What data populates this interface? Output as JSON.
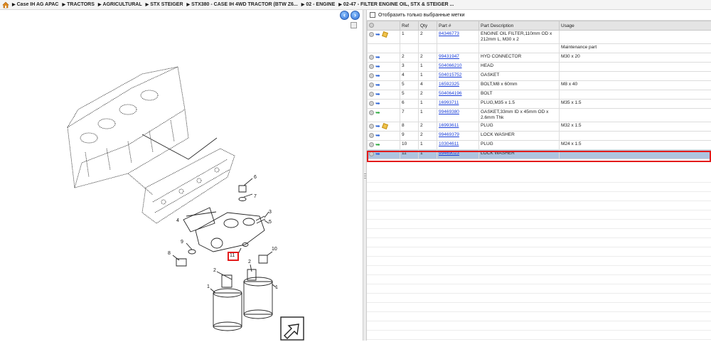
{
  "breadcrumb": [
    "Case IH AG APAC",
    "TRACTORS",
    "AGRICULTURAL",
    "STX STEIGER",
    "STX380 - CASE IH 4WD TRACTOR (BTW Z6...",
    "02 - ENGINE",
    "02-47 - FILTER ENGINE OIL, STX & STEIGER ..."
  ],
  "filter": {
    "label": "Отобразить только выбранные метки"
  },
  "table": {
    "headers": {
      "ref": "Ref",
      "qty": "Qty",
      "part": "Part #",
      "desc": "Part Description",
      "usage": "Usage"
    },
    "rows": [
      {
        "ref": "1",
        "qty": "2",
        "part": "84346773",
        "desc": "ENGINE OIL FILTER,110mm OD x 212mm L, M30 x 2",
        "usage": "",
        "arrow": "blue",
        "box": true
      },
      {
        "ref": "",
        "qty": "",
        "part": "",
        "desc": "",
        "usage": "Maintenance part",
        "arrow": "",
        "box": false
      },
      {
        "ref": "2",
        "qty": "2",
        "part": "99431947",
        "desc": "HYD CONNECTOR",
        "usage": "M30 x 20",
        "arrow": "blue",
        "box": false
      },
      {
        "ref": "3",
        "qty": "1",
        "part": "504066210",
        "desc": "HEAD",
        "usage": "",
        "arrow": "blue",
        "box": false
      },
      {
        "ref": "4",
        "qty": "1",
        "part": "504015752",
        "desc": "GASKET",
        "usage": "",
        "arrow": "blue",
        "box": false
      },
      {
        "ref": "5",
        "qty": "4",
        "part": "16592325",
        "desc": "BOLT,M8 x 60mm",
        "usage": "M8 x 40",
        "arrow": "blue",
        "box": false
      },
      {
        "ref": "5",
        "qty": "2",
        "part": "504064196",
        "desc": "BOLT",
        "usage": "",
        "arrow": "blue",
        "box": false
      },
      {
        "ref": "6",
        "qty": "1",
        "part": "16993711",
        "desc": "PLUG,M35 x 1.5",
        "usage": "M35 x 1.5",
        "arrow": "blue",
        "box": false
      },
      {
        "ref": "7",
        "qty": "1",
        "part": "99469380",
        "desc": "GASKET,33mm ID x 45mm OD x 2.6mm Thk",
        "usage": "",
        "arrow": "green",
        "box": false
      },
      {
        "ref": "8",
        "qty": "2",
        "part": "16993611",
        "desc": "PLUG",
        "usage": "M32 x 1.5",
        "arrow": "blue",
        "box": true
      },
      {
        "ref": "9",
        "qty": "2",
        "part": "99469379",
        "desc": "LOCK WASHER",
        "usage": "",
        "arrow": "blue",
        "box": false
      },
      {
        "ref": "10",
        "qty": "1",
        "part": "10304611",
        "desc": "PLUG",
        "usage": "M24 x 1.5",
        "arrow": "green",
        "box": false
      },
      {
        "ref": "11",
        "qty": "1",
        "part": "99469023",
        "desc": "LOCK WASHER",
        "usage": "",
        "arrow": "blue",
        "box": false,
        "selected": true
      }
    ]
  },
  "callouts": [
    "1",
    "1",
    "2",
    "2",
    "3",
    "4",
    "5",
    "6",
    "7",
    "8",
    "9",
    "10",
    "11"
  ],
  "colors": {
    "accent_red": "#e31b1b",
    "selected_row": "#aec4df",
    "link": "#1a3ed8"
  }
}
